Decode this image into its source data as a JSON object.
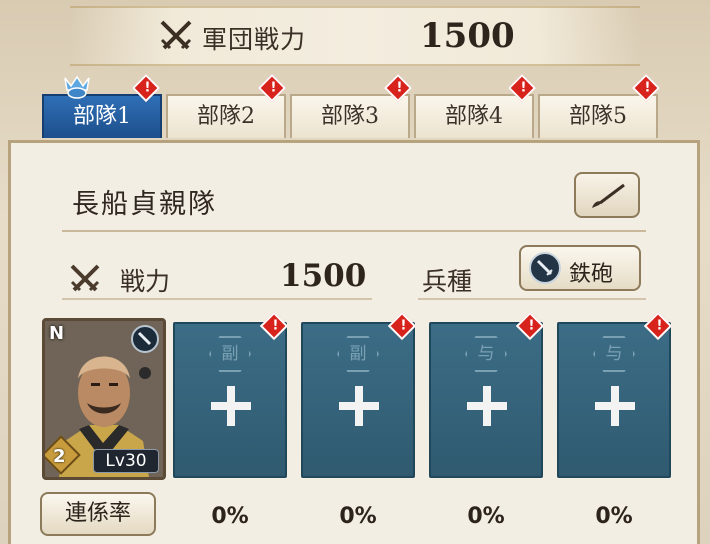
{
  "header": {
    "power_label": "軍団戦力",
    "power_value": "1500",
    "swords_icon": "crossed-swords-icon"
  },
  "tabs": [
    {
      "label": "部隊1",
      "active": true
    },
    {
      "label": "部隊2",
      "active": false
    },
    {
      "label": "部隊3",
      "active": false
    },
    {
      "label": "部隊4",
      "active": false
    },
    {
      "label": "部隊5",
      "active": false
    }
  ],
  "unit": {
    "name": "長船貞親隊",
    "power_label": "戦力",
    "power_value": "1500",
    "troop_label": "兵種",
    "troop_type": "鉄砲"
  },
  "officer": {
    "rarity": "N",
    "star": "2",
    "level": "Lv30"
  },
  "slots": [
    {
      "role": "副"
    },
    {
      "role": "副"
    },
    {
      "role": "与"
    },
    {
      "role": "与"
    }
  ],
  "link_label": "連係率",
  "link_rates": [
    "0%",
    "0%",
    "0%",
    "0%"
  ],
  "colors": {
    "active_tab": "#1d4f8c",
    "slot_bg": "#2f5a70",
    "alert": "#d8231d"
  }
}
